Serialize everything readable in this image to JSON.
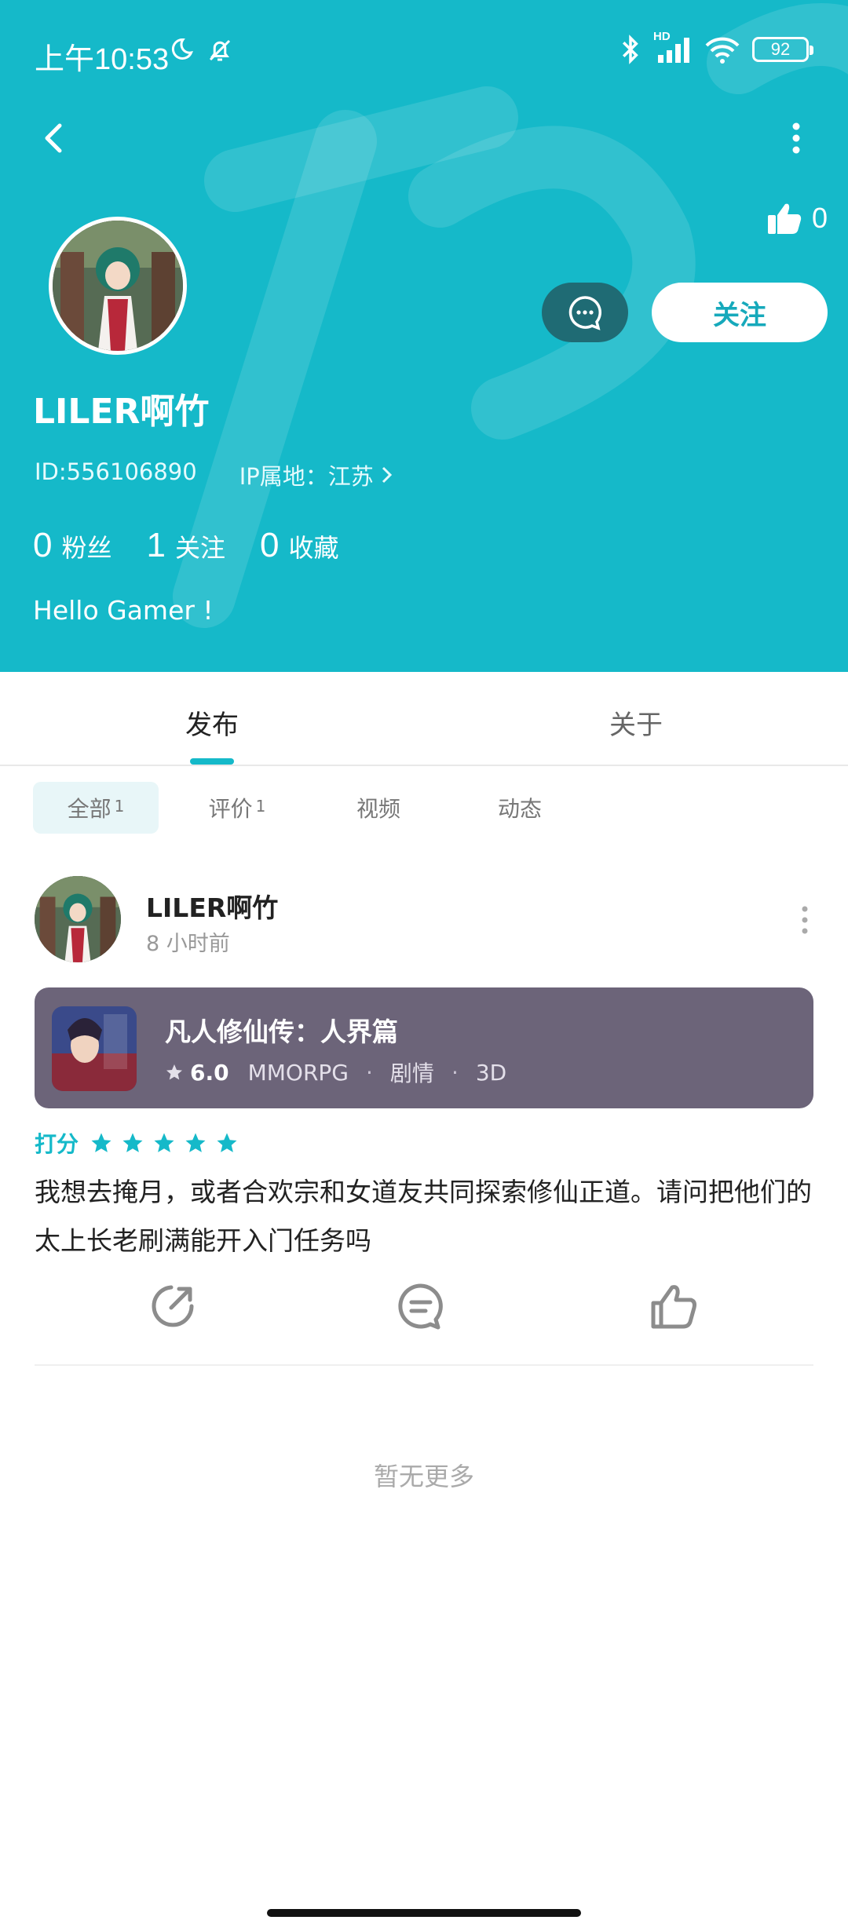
{
  "status_bar": {
    "time": "上午10:53",
    "network_label": "HD",
    "battery": "92",
    "icons": [
      "moon-icon",
      "bell-off-icon",
      "bluetooth-icon",
      "signal-icon",
      "wifi-icon",
      "battery-icon"
    ]
  },
  "header": {
    "back_icon": "chevron-left-icon",
    "more_icon": "more-vertical-icon",
    "like_count": "0",
    "follow_label": "关注",
    "username": "LILER啊竹",
    "id_text": "ID:556106890",
    "ip_text": "IP属地：江苏",
    "stats": [
      {
        "num": "0",
        "label": "粉丝"
      },
      {
        "num": "1",
        "label": "关注"
      },
      {
        "num": "0",
        "label": "收藏"
      }
    ],
    "bio": "Hello Gamer !"
  },
  "tabs": {
    "publish": "发布",
    "about": "关于"
  },
  "filters": [
    {
      "label": "全部",
      "count": "1"
    },
    {
      "label": "评价",
      "count": "1"
    },
    {
      "label": "视频",
      "count": ""
    },
    {
      "label": "动态",
      "count": ""
    }
  ],
  "post": {
    "username": "LILER啊竹",
    "time": "8 小时前",
    "game": {
      "title": "凡人修仙传：人界篇",
      "score": "6.0",
      "tags": [
        "MMORPG",
        "剧情",
        "3D"
      ]
    },
    "rating_label": "打分",
    "rating_stars": 5,
    "body": "我想去掩月，或者合欢宗和女道友共同探索修仙正道。请问把他们的太上长老刷满能开入门任务吗"
  },
  "footer": {
    "no_more": "暂无更多"
  },
  "colors": {
    "accent": "#15b9c9",
    "card": "#6c6479",
    "message_button": "#1f6b74"
  }
}
